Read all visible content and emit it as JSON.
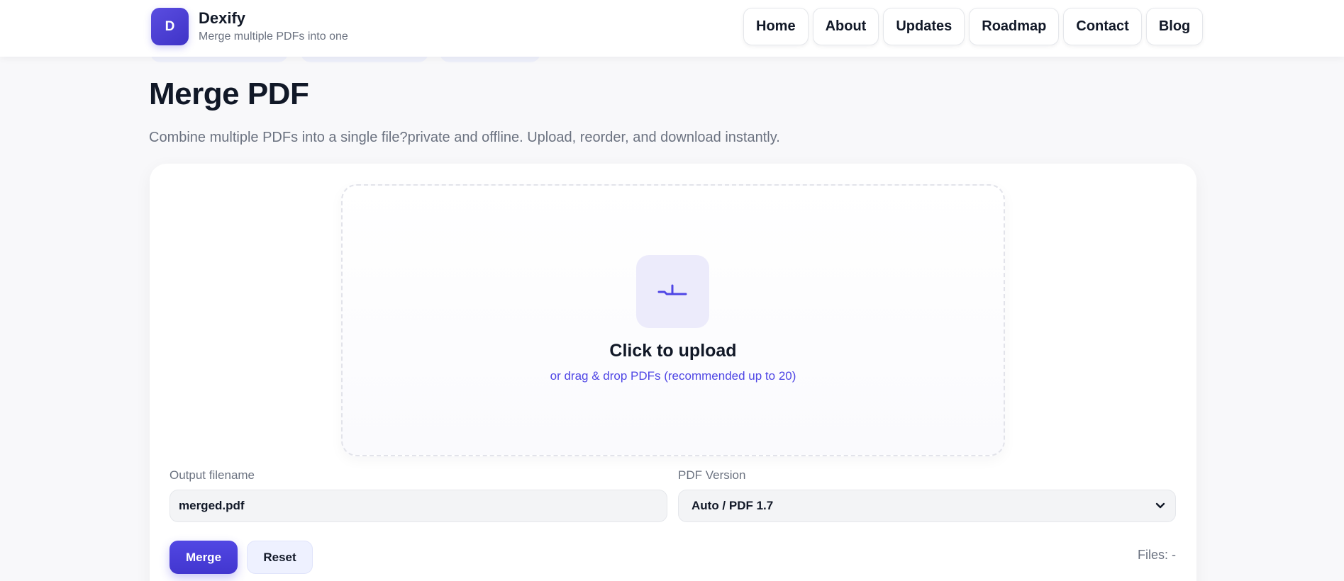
{
  "brand": {
    "logo_letter": "D",
    "name": "Dexify",
    "tagline": "Merge multiple PDFs into one"
  },
  "nav": {
    "items": [
      {
        "label": "Home"
      },
      {
        "label": "About"
      },
      {
        "label": "Updates"
      },
      {
        "label": "Roadmap"
      },
      {
        "label": "Contact"
      },
      {
        "label": "Blog"
      }
    ]
  },
  "page": {
    "title": "Merge PDF",
    "subtitle": "Combine multiple PDFs into a single file?private and offline. Upload, reorder, and download instantly."
  },
  "upload": {
    "icon": "upload-icon",
    "title": "Click to upload",
    "hint": "or drag & drop PDFs (recommended up to 20)"
  },
  "form": {
    "filename_label": "Output filename",
    "filename_value": "merged.pdf",
    "version_label": "PDF Version",
    "version_value": "Auto / PDF 1.7"
  },
  "actions": {
    "merge_label": "Merge",
    "reset_label": "Reset",
    "files_count": "Files: -"
  },
  "colors": {
    "accent": "#4f46e5",
    "background": "#f8f8fa",
    "text": "#111827",
    "muted": "#6b7280"
  }
}
